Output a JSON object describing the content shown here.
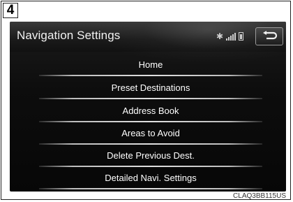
{
  "step_number": "4",
  "header": {
    "title": "Navigation Settings",
    "bluetooth_glyph": "✱",
    "status_icons": [
      "bluetooth-icon",
      "signal-icon",
      "battery-icon"
    ],
    "back_icon": "return-arrow-icon"
  },
  "menu": {
    "items": [
      {
        "label": "Home"
      },
      {
        "label": "Preset Destinations"
      },
      {
        "label": "Address Book"
      },
      {
        "label": "Areas to Avoid"
      },
      {
        "label": "Delete Previous Dest."
      },
      {
        "label": "Detailed Navi. Settings"
      }
    ]
  },
  "caption": "CLAQ3BB115US",
  "colors": {
    "screen_background": "#0d0d0d",
    "text": "#ffffff",
    "divider": "#d0d0d0"
  }
}
